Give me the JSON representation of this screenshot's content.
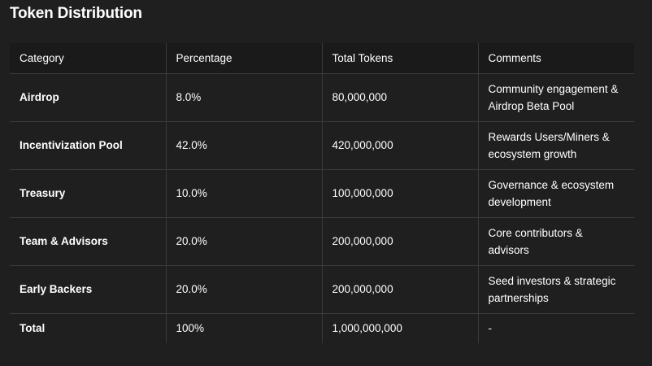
{
  "title": "Token Distribution",
  "table": {
    "headers": [
      "Category",
      "Percentage",
      "Total Tokens",
      "Comments"
    ],
    "rows": [
      {
        "category": "Airdrop",
        "percentage": "8.0%",
        "tokens": "80,000,000",
        "comments": "Community engagement & Airdrop Beta Pool"
      },
      {
        "category": "Incentivization Pool",
        "percentage": "42.0%",
        "tokens": "420,000,000",
        "comments": "Rewards Users/Miners & ecosystem growth"
      },
      {
        "category": "Treasury",
        "percentage": "10.0%",
        "tokens": "100,000,000",
        "comments": "Governance & ecosystem development"
      },
      {
        "category": "Team & Advisors",
        "percentage": "20.0%",
        "tokens": "200,000,000",
        "comments": "Core contributors & advisors"
      },
      {
        "category": "Early Backers",
        "percentage": "20.0%",
        "tokens": "200,000,000",
        "comments": "Seed investors & strategic partnerships"
      },
      {
        "category": "Total",
        "percentage": "100%",
        "tokens": "1,000,000,000",
        "comments": "-"
      }
    ]
  }
}
